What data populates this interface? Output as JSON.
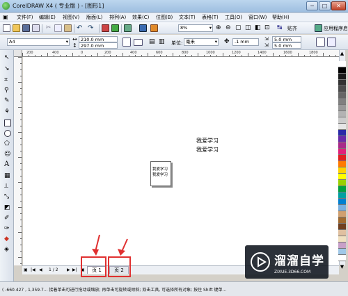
{
  "window": {
    "title": "CorelDRAW X4 ( 专业版 ) - [图形1]",
    "controls": [
      "─",
      "□",
      "✕"
    ]
  },
  "menu": [
    "文件(F)",
    "编辑(E)",
    "视图(V)",
    "版面(L)",
    "排列(A)",
    "效果(C)",
    "位图(B)",
    "文本(T)",
    "表格(T)",
    "工具(O)",
    "窗口(W)",
    "帮助(H)"
  ],
  "toolbar": {
    "zoom": "8%",
    "snap_label": "贴齐",
    "launcher_label": "应用程序启动器"
  },
  "property_bar": {
    "paper_size": "A4",
    "width": "210.0 mm",
    "height": "297.0 mm",
    "units_label": "单位:",
    "units_value": "毫米",
    "nudge": ".1 mm",
    "dup_x": "5.0 mm",
    "dup_y": "5.0 mm"
  },
  "ruler_labels": [
    "200",
    "400",
    "0",
    "200",
    "400",
    "600",
    "800",
    "1000",
    "1200",
    "1400",
    "1600",
    "1800"
  ],
  "canvas": {
    "page_text_line1": "我爱学习",
    "page_text_line2": "我爱学习",
    "big_text_line1": "我爱学习",
    "big_text_line2": "我爱学习"
  },
  "page_nav": {
    "page_counter": "1 / 2",
    "tab1": "页 1",
    "tab2": "页 2"
  },
  "status": "( -660.427 , 1,359.7...  接着单击可进行拖动或缩放; 再单击可旋转或倾斜; 双击工具, 可选择所有对象; 按住 Shift 键单...",
  "watermark": {
    "title": "溜溜自学",
    "subtitle": "ZIXUE.3D66.COM"
  },
  "palette_colors": [
    "#ffffff",
    "#000000",
    "#1a1a1a",
    "#333333",
    "#4d4d4d",
    "#666666",
    "#808080",
    "#999999",
    "#b3b3b3",
    "#cccccc",
    "#e6e6e6",
    "#2a2aa8",
    "#6a2aa8",
    "#a82a8a",
    "#e0207a",
    "#e02020",
    "#ff7a00",
    "#ffd200",
    "#ffff00",
    "#9ad000",
    "#00a040",
    "#00a0a0",
    "#0080d0",
    "#7ab0e0",
    "#d0a070",
    "#a06a30",
    "#704020",
    "#e0c0a0",
    "#f0e0c0",
    "#c8a0c8",
    "#a0c8e8",
    "#ffffff"
  ],
  "accent_red": "#e03030"
}
